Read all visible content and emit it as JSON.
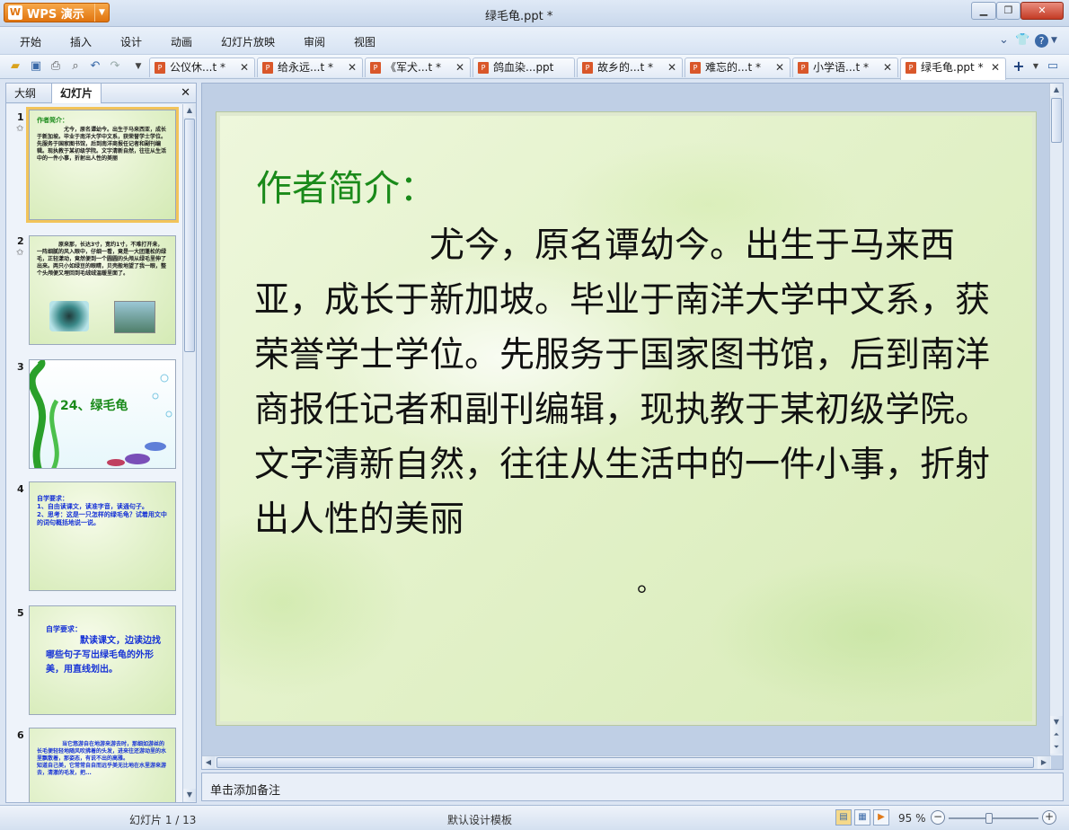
{
  "window": {
    "app_name": "WPS 演示",
    "title": "绿毛龟.ppt *",
    "min": "▁",
    "max": "❐",
    "close": "✕"
  },
  "menu": [
    "开始",
    "插入",
    "设计",
    "动画",
    "幻灯片放映",
    "审阅",
    "视图"
  ],
  "toolbar": {
    "doc_tabs": [
      {
        "label": "公仪休...t *"
      },
      {
        "label": "给永远...t *"
      },
      {
        "label": "《军犬...t *"
      },
      {
        "label": "鸽血染...ppt"
      },
      {
        "label": "故乡的...t *"
      },
      {
        "label": "难忘的...t *"
      },
      {
        "label": "小学语...t *"
      },
      {
        "label": "绿毛龟.ppt *"
      }
    ],
    "close_glyph": "✕",
    "new_tab_glyph": "+"
  },
  "left_panel": {
    "tab_outline": "大纲",
    "tab_slides": "幻灯片",
    "close_glyph": "✕",
    "slides": [
      {
        "num": "1",
        "title": "作者简介：",
        "text": "尤今，原名谭幼今。出生于马来西亚，成长于新加坡。毕业于南洋大学中文系，获荣誉学士学位。先服务于国家图书馆，后到南洋商报任记者和副刊编辑。现执教于某初级学院。文字清新自然，往往从生活中的一件小事，折射出人性的美丽"
      },
      {
        "num": "2",
        "text": "原来那，长达3寸，宽约1寸，不难打开来，一阵细腻的风入眼中，仔细一看，竟是一大团蓬松的绿毛，正轻漾动，竟然便到一个圆圆的头颅从绿毛里伸了出来。两只小如绿豆的眼睛，贝壳般地望了我一眼，整个头颅便又埋回到毛绒绒温暖里面了。"
      },
      {
        "num": "3",
        "title": "24、绿毛龟"
      },
      {
        "num": "4",
        "text": "自学要求：\n1、自由读课文，读准字音，读通句子。\n2、思考：这是一只怎样的绿毛龟？试着用文中的词句概括地说一说。"
      },
      {
        "num": "5",
        "heading": "自学要求：",
        "text": "默读课文，边读边找哪些句子写出绿毛龟的外形美，用直线划出。"
      },
      {
        "num": "6",
        "text": "当它悠游自在地游来游去时，那细如游丝的长毛便轻轻地随风吹拂着的头发，进来往还游动里的水里飘散着，那姿态，有说不出的高雅。\n知道自己美，它常常自自而远乎美无比地在水里游来游去，清澈的毛发，把..."
      }
    ]
  },
  "slide": {
    "title": "作者简介：",
    "body": "尤今，原名谭幼今。出生于马来西亚，成长于新加坡。毕业于南洋大学中文系，获荣誉学士学位。先服务于国家图书馆，后到南洋商报任记者和副刊编辑，现执教于某初级学院。文字清新自然，往往从生活中的一件小事，折射出人性的美丽",
    "tail": "。"
  },
  "notes": {
    "placeholder": "单击添加备注"
  },
  "status": {
    "slide_counter": "幻灯片 1 / 13",
    "template": "默认设计模板",
    "zoom": "95 %",
    "zoom_fraction": 0.45
  }
}
